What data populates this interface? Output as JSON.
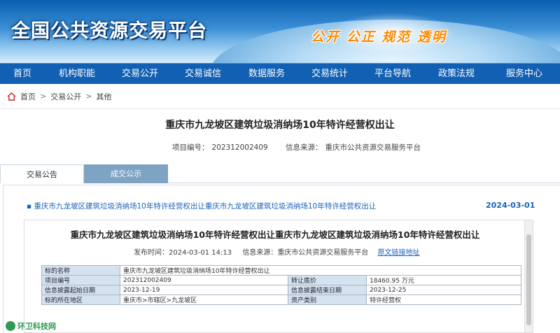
{
  "banner": {
    "title": "全国公共资源交易平台",
    "slogan": "公开 公正 规范 透明"
  },
  "nav": [
    "首页",
    "机构职能",
    "交易公开",
    "交易诚信",
    "数据服务",
    "交易统计",
    "平台导航",
    "政策法规",
    "服务中心"
  ],
  "breadcrumb": {
    "home": "首页",
    "sep": ">",
    "level1": "交易公开",
    "level2": "其他"
  },
  "article": {
    "title": "重庆市九龙坡区建筑垃圾消纳场10年特许经营权出让",
    "project_no_label": "项目编号：",
    "project_no": "202312002409",
    "source_label": "信息来源：",
    "source": "重庆市公共资源交易服务平台"
  },
  "tabs": [
    "交易公告",
    "成交公示"
  ],
  "listing": {
    "link_text": "重庆市九龙坡区建筑垃圾消纳场10年特许经营权出让重庆市九龙坡区建筑垃圾消纳场10年特许经营权出让",
    "date": "2024-03-01"
  },
  "document": {
    "title": "重庆市九龙坡区建筑垃圾消纳场10年特许经营权出让重庆市九龙坡区建筑垃圾消纳场10年特许经营权出让",
    "publish_label": "发布时间：",
    "publish_time": "2024-03-01 14:13",
    "source_label": "信息来源：",
    "source": "重庆市公共资源交易服务平台",
    "orig_link": "原文链接地址",
    "rows": [
      {
        "k1": "标的名称",
        "v1": "重庆市九龙坡区建筑垃圾消纳场10年特许经营权出让",
        "k2": "",
        "v2": ""
      },
      {
        "k1": "项目编号",
        "v1": "202312002409",
        "k2": "转让底价",
        "v2": "18460.95 万元"
      },
      {
        "k1": "信息披露起始日期",
        "v1": "2023-12-19",
        "k2": "信息披露结束日期",
        "v2": "2023-12-25"
      },
      {
        "k1": "标的所在地区",
        "v1": "重庆市>市辖区>九龙坡区",
        "k2": "资产类别",
        "v2": "特许经营权"
      }
    ]
  },
  "watermark": "环卫科技网"
}
